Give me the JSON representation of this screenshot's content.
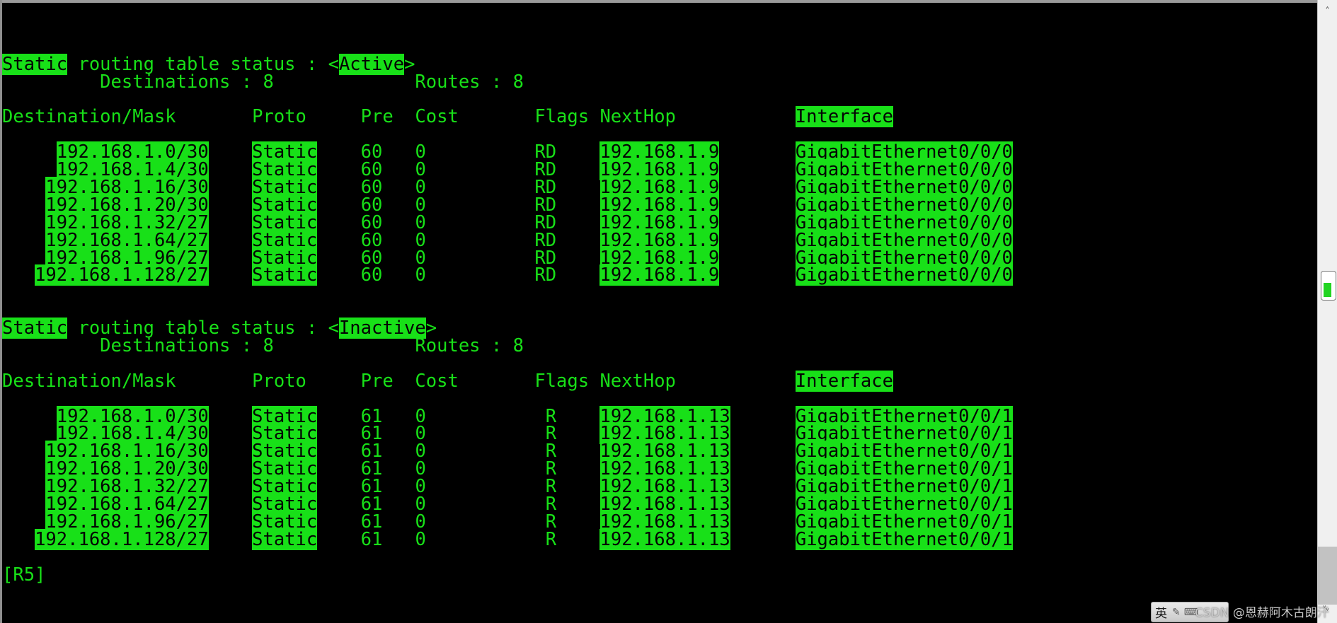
{
  "terminal": {
    "prompt": "[R5]",
    "foreground_color": "#18e018",
    "background_color": "#000000",
    "highlight_background": "#18e018",
    "highlight_foreground": "#040404"
  },
  "sections": [
    {
      "status_prefix": "Static",
      "status_middle": " routing table status : <",
      "status_value": "Active",
      "status_suffix": ">",
      "summary": {
        "destinations_label": "Destinations :",
        "destinations_value": "8",
        "routes_label": "Routes :",
        "routes_value": "8"
      },
      "columns": {
        "destination": "Destination/Mask",
        "proto": "Proto",
        "pre": "Pre",
        "cost": "Cost",
        "flags": "Flags",
        "nexthop": "NextHop",
        "interface": "Interface"
      },
      "rows": [
        {
          "destination": "192.168.1.0/30",
          "proto": "Static",
          "pre": "60",
          "cost": "0",
          "flags": "RD",
          "nexthop": "192.168.1.9",
          "interface": "GigabitEthernet0/0/0"
        },
        {
          "destination": "192.168.1.4/30",
          "proto": "Static",
          "pre": "60",
          "cost": "0",
          "flags": "RD",
          "nexthop": "192.168.1.9",
          "interface": "GigabitEthernet0/0/0"
        },
        {
          "destination": "192.168.1.16/30",
          "proto": "Static",
          "pre": "60",
          "cost": "0",
          "flags": "RD",
          "nexthop": "192.168.1.9",
          "interface": "GigabitEthernet0/0/0"
        },
        {
          "destination": "192.168.1.20/30",
          "proto": "Static",
          "pre": "60",
          "cost": "0",
          "flags": "RD",
          "nexthop": "192.168.1.9",
          "interface": "GigabitEthernet0/0/0"
        },
        {
          "destination": "192.168.1.32/27",
          "proto": "Static",
          "pre": "60",
          "cost": "0",
          "flags": "RD",
          "nexthop": "192.168.1.9",
          "interface": "GigabitEthernet0/0/0"
        },
        {
          "destination": "192.168.1.64/27",
          "proto": "Static",
          "pre": "60",
          "cost": "0",
          "flags": "RD",
          "nexthop": "192.168.1.9",
          "interface": "GigabitEthernet0/0/0"
        },
        {
          "destination": "192.168.1.96/27",
          "proto": "Static",
          "pre": "60",
          "cost": "0",
          "flags": "RD",
          "nexthop": "192.168.1.9",
          "interface": "GigabitEthernet0/0/0"
        },
        {
          "destination": "192.168.1.128/27",
          "proto": "Static",
          "pre": "60",
          "cost": "0",
          "flags": "RD",
          "nexthop": "192.168.1.9",
          "interface": "GigabitEthernet0/0/0"
        }
      ]
    },
    {
      "status_prefix": "Static",
      "status_middle": " routing table status : <",
      "status_value": "Inactive",
      "status_suffix": ">",
      "summary": {
        "destinations_label": "Destinations :",
        "destinations_value": "8",
        "routes_label": "Routes :",
        "routes_value": "8"
      },
      "columns": {
        "destination": "Destination/Mask",
        "proto": "Proto",
        "pre": "Pre",
        "cost": "Cost",
        "flags": "Flags",
        "nexthop": "NextHop",
        "interface": "Interface"
      },
      "rows": [
        {
          "destination": "192.168.1.0/30",
          "proto": "Static",
          "pre": "61",
          "cost": "0",
          "flags": "R",
          "nexthop": "192.168.1.13",
          "interface": "GigabitEthernet0/0/1"
        },
        {
          "destination": "192.168.1.4/30",
          "proto": "Static",
          "pre": "61",
          "cost": "0",
          "flags": "R",
          "nexthop": "192.168.1.13",
          "interface": "GigabitEthernet0/0/1"
        },
        {
          "destination": "192.168.1.16/30",
          "proto": "Static",
          "pre": "61",
          "cost": "0",
          "flags": "R",
          "nexthop": "192.168.1.13",
          "interface": "GigabitEthernet0/0/1"
        },
        {
          "destination": "192.168.1.20/30",
          "proto": "Static",
          "pre": "61",
          "cost": "0",
          "flags": "R",
          "nexthop": "192.168.1.13",
          "interface": "GigabitEthernet0/0/1"
        },
        {
          "destination": "192.168.1.32/27",
          "proto": "Static",
          "pre": "61",
          "cost": "0",
          "flags": "R",
          "nexthop": "192.168.1.13",
          "interface": "GigabitEthernet0/0/1"
        },
        {
          "destination": "192.168.1.64/27",
          "proto": "Static",
          "pre": "61",
          "cost": "0",
          "flags": "R",
          "nexthop": "192.168.1.13",
          "interface": "GigabitEthernet0/0/1"
        },
        {
          "destination": "192.168.1.96/27",
          "proto": "Static",
          "pre": "61",
          "cost": "0",
          "flags": "R",
          "nexthop": "192.168.1.13",
          "interface": "GigabitEthernet0/0/1"
        },
        {
          "destination": "192.168.1.128/27",
          "proto": "Static",
          "pre": "61",
          "cost": "0",
          "flags": "R",
          "nexthop": "192.168.1.13",
          "interface": "GigabitEthernet0/0/1"
        }
      ]
    }
  ],
  "scrollbar": {
    "up_arrow": "˄",
    "down_arrow": "˅"
  },
  "ime": {
    "mode_label": "英",
    "glyph_1": "✎",
    "glyph_2": "⌨",
    "caret": "˅"
  },
  "watermark": {
    "text": "CSDN @恩赫阿木古朗汗"
  }
}
